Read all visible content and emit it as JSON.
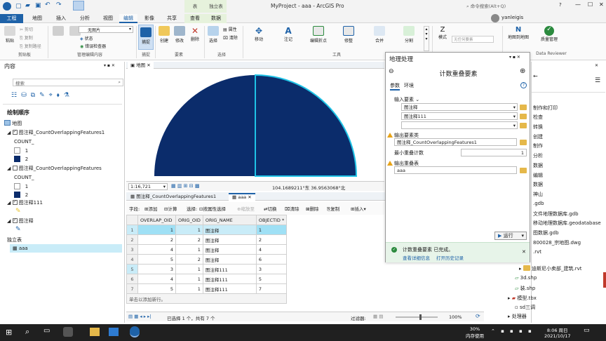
{
  "title": {
    "app": "MyProject - aaa - ArcGIS Pro",
    "ctx_table": "表",
    "ctx_feature": "独立表",
    "search": "命令搜索(Alt+Q)",
    "user": "yanleigis",
    "help": "?"
  },
  "tabs": [
    "工程",
    "地图",
    "插入",
    "分析",
    "视图",
    "编辑",
    "影像",
    "共享",
    "查看",
    "数据"
  ],
  "ribbon": {
    "clipboard": {
      "paste": "粘贴",
      "cut": "剪切",
      "copy": "复制",
      "copy_path": "复制路径",
      "group": "剪贴板"
    },
    "manage": {
      "manage_edits": "管理编辑内容",
      "group": "管理编辑内容",
      "no_tpl": "无图片",
      "status": "状态",
      "error_inspector": "错误检查器"
    },
    "snap": {
      "label": "捕捉",
      "group": "捕捉"
    },
    "features": {
      "create": "创建",
      "modify": "修改",
      "delete": "删除",
      "group": "要素"
    },
    "selection": {
      "select": "选择",
      "attributes": "属性",
      "clear": "清除",
      "group": "选择"
    },
    "tools": {
      "move": "移动",
      "annotate": "注记",
      "edit_vertices": "编辑折点",
      "reshape": "修整",
      "merge": "合并",
      "split": "分割",
      "group": "工具"
    },
    "mode": {
      "label": "模式",
      "unspecified": "无任何要素"
    },
    "data_reviewer": {
      "map_id": "地图到地图",
      "quality": "质量管理",
      "group": "Data Reviewer"
    }
  },
  "contents": {
    "header": "内容",
    "search": "搜索",
    "draw_order": "绘制顺序",
    "map": "地图",
    "layer1": "图注释_CountOverlappingFeatures1",
    "count_label": "COUNT_",
    "v1": "1",
    "v2": "2",
    "layer2": "图注释_CountOverlappingFeatures",
    "layer3": "图注释111",
    "layer4": "图注释",
    "standalone": "独立表",
    "table_aaa": "aaa"
  },
  "map": {
    "tab": "地图",
    "scale": "1:16,721",
    "coords": "104.1689211°东 36.9563068°北"
  },
  "table_view": {
    "tab1": "图注释_CountOverlappingFeatures1",
    "tab2": "aaa",
    "toolbar": {
      "fields": "字段:",
      "add": "添加",
      "calculate": "计算",
      "select": "选择:",
      "by_attr": "按属性选择",
      "zoom": "缩放至",
      "toggle": "切换",
      "clear": "清除",
      "delete": "删除",
      "copy": "复制",
      "insert": "插入"
    },
    "columns": [
      "OVERLAP_OID",
      "ORIG_OID",
      "ORIG_NAME",
      "OBJECTID *"
    ],
    "rows": [
      [
        "1",
        "1",
        "1",
        "图注释",
        "1"
      ],
      [
        "2",
        "2",
        "2",
        "图注释",
        "2"
      ],
      [
        "3",
        "4",
        "1",
        "图注释",
        "4"
      ],
      [
        "4",
        "5",
        "2",
        "图注释",
        "6"
      ],
      [
        "5",
        "3",
        "1",
        "图注释111",
        "3"
      ],
      [
        "6",
        "4",
        "1",
        "图注释111",
        "5"
      ],
      [
        "7",
        "5",
        "1",
        "图注释111",
        "7"
      ]
    ],
    "add_row": "单击以添加新行。",
    "status": "已选择 1 个，共有 7 个",
    "filter": "过滤器:",
    "zoom": "100%"
  },
  "gp": {
    "title": "地理处理",
    "tool": "计数重叠要素",
    "tab_params": "参数",
    "tab_env": "环境",
    "input": "输入要素",
    "in1": "图注释",
    "in2": "图注释111",
    "output_fc": "输出要素类",
    "out_fc": "图注释_CountOverlappingFeatures1",
    "min_overlap": "最小重叠计数",
    "min_val": "1",
    "output_table": "输出重叠表",
    "out_tbl": "aaa",
    "run": "运行",
    "done": "计数重叠要素 已完成。",
    "details": "查看详细信息",
    "history": "打开历史记录"
  },
  "catalog": {
    "items": [
      "制作和打印",
      "检查",
      "转换",
      "创建",
      "制作",
      "分析",
      "数据",
      "编辑",
      "数据",
      "神山",
      ".gdb",
      "文件地理数据库.gdb",
      "移动地理数据库.geodatabase",
      "图数据.gdb",
      "800028_宗地图.dwg",
      ".rvt",
      "迪斯尼小卖部_建筑.rvt",
      "3d.shp",
      "装.shp",
      "模型.tbx",
      "sd三调",
      "处理器"
    ]
  },
  "taskbar": {
    "cpu": "30%",
    "cpu_label": "内存使用",
    "time": "8:06 周日",
    "date": "2021/10/17"
  },
  "colors": {
    "accent": "#1e62a8",
    "fill_dark": "#0b2c6b",
    "select": "#1fc3e6",
    "hilite": "#c9ecf8",
    "green": "#2b8a3e"
  }
}
